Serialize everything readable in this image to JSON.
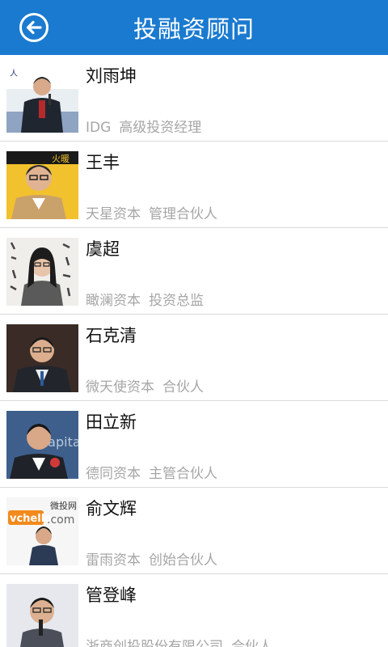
{
  "header": {
    "title": "投融资顾问",
    "back_icon": "back-arrow-circle-icon"
  },
  "advisors": [
    {
      "name": "刘雨坤",
      "company": "IDG",
      "title": "高级投资经理"
    },
    {
      "name": "王丰",
      "company": "天星资本",
      "title": "管理合伙人"
    },
    {
      "name": "虞超",
      "company": "瞰澜资本",
      "title": "投资总监"
    },
    {
      "name": "石克清",
      "company": "微天使资本",
      "title": "合伙人"
    },
    {
      "name": "田立新",
      "company": "德同资本",
      "title": "主管合伙人"
    },
    {
      "name": "俞文辉",
      "company": "雷雨资本",
      "title": "创始合伙人"
    },
    {
      "name": "管登峰",
      "company": "浙商创投股份有限公司",
      "title": "合伙人"
    }
  ],
  "photo_text": {
    "p1": "人",
    "p2": "火暖",
    "p6_brand": "vchello",
    "p6_cn": "微投网",
    "p6_com": ".com",
    "p5_bg": "Capital"
  },
  "colors": {
    "header": "#1a7ad0",
    "name": "#111111",
    "desc": "#a6a6a6",
    "divider": "#d9d9d9"
  }
}
